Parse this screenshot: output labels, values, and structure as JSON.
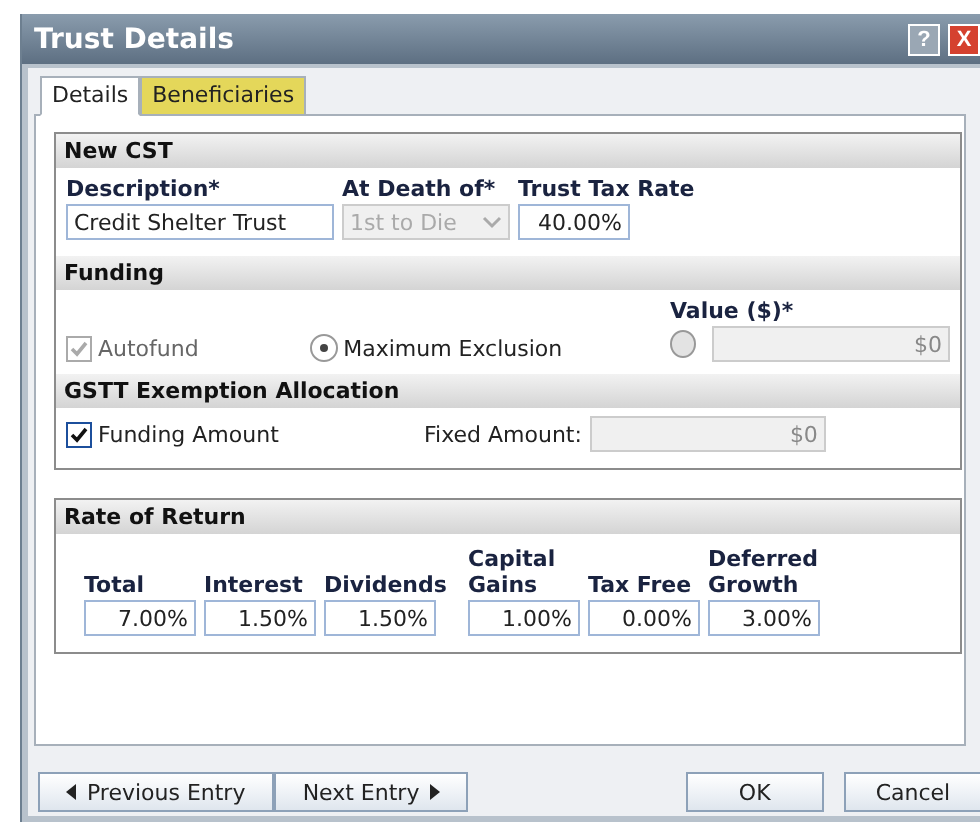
{
  "window": {
    "title": "Trust Details",
    "help": "?",
    "close": "X"
  },
  "tabs": [
    {
      "label": "Details",
      "selected": true
    },
    {
      "label": "Beneficiaries",
      "selected": false
    }
  ],
  "new_cst": {
    "title": "New CST",
    "description": {
      "label": "Description*",
      "value": "Credit Shelter Trust"
    },
    "at_death_of": {
      "label": "At Death of*",
      "value": "1st to Die",
      "disabled": true
    },
    "trust_tax_rate": {
      "label": "Trust Tax Rate",
      "value": "40.00%"
    }
  },
  "funding": {
    "title": "Funding",
    "autofund": {
      "label": "Autofund",
      "checked": true,
      "disabled": true
    },
    "options": [
      {
        "label": "Maximum Exclusion",
        "selected": true
      },
      {
        "selected": false
      }
    ],
    "value": {
      "label": "Value ($)*",
      "value": "$0",
      "disabled": true
    }
  },
  "gstt": {
    "title": "GSTT Exemption Allocation",
    "funding_amount": {
      "label": "Funding Amount",
      "checked": true
    },
    "fixed_amount": {
      "label": "Fixed Amount:",
      "value": "$0",
      "disabled": true
    }
  },
  "rate_of_return": {
    "title": "Rate of Return",
    "columns": [
      {
        "label": "Total",
        "value": "7.00%"
      },
      {
        "label": "Interest",
        "value": "1.50%"
      },
      {
        "label": "Dividends",
        "value": "1.50%"
      },
      {
        "label": "Capital Gains",
        "value": "1.00%"
      },
      {
        "label": "Tax Free",
        "value": "0.00%"
      },
      {
        "label": "Deferred Growth",
        "value": "3.00%"
      }
    ]
  },
  "buttons": {
    "previous": "Previous Entry",
    "next": "Next Entry",
    "ok": "OK",
    "cancel": "Cancel"
  }
}
